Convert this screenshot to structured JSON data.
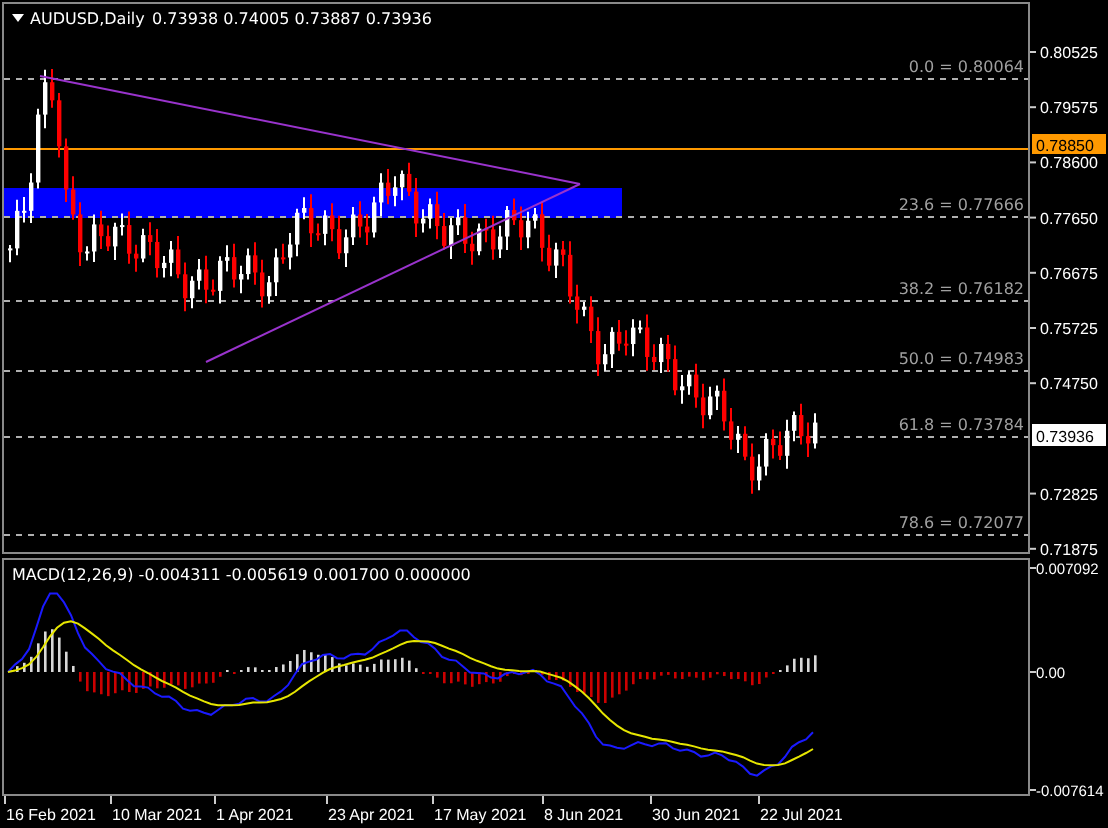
{
  "chart": {
    "title": "AUDUSD,Daily",
    "ohlc": "0.73938 0.74005 0.73887 0.73936",
    "price_axis": [
      "0.80525",
      "0.79575",
      "0.78600",
      "0.77650",
      "0.76675",
      "0.75725",
      "0.74750",
      "0.72825",
      "0.71875"
    ],
    "fib_levels": [
      {
        "label": "0.0 = 0.80064"
      },
      {
        "label": "23.6 = 0.77666"
      },
      {
        "label": "38.2 = 0.76182"
      },
      {
        "label": "50.0 = 0.74983"
      },
      {
        "label": "61.8 = 0.73784"
      },
      {
        "label": "78.6 = 0.72077"
      }
    ],
    "line_price": "0.78850",
    "current_price": "0.73936"
  },
  "macd": {
    "title": "MACD(12,26,9) -0.004311 -0.005619 0.001700 0.000000",
    "axis": [
      "0.007092",
      "0.00",
      "-0.007614"
    ]
  },
  "dates": [
    "16 Feb 2021",
    "10 Mar 2021",
    "1 Apr 2021",
    "23 Apr 2021",
    "17 May 2021",
    "8 Jun 2021",
    "30 Jun 2021",
    "22 Jul 2021"
  ]
}
